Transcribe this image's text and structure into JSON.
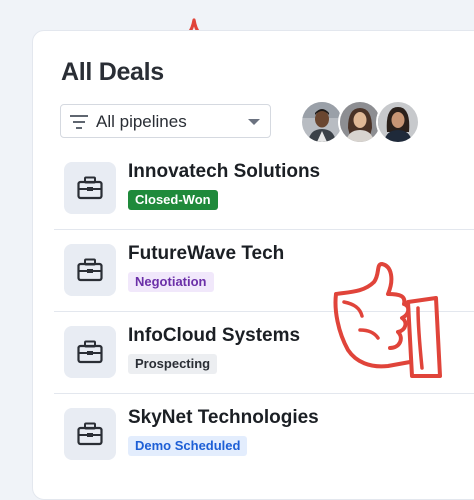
{
  "page": {
    "title": "All Deals"
  },
  "filter": {
    "selected": "All pipelines",
    "icon": "filter-icon"
  },
  "deals": [
    {
      "name": "Innovatech Solutions",
      "stage": "Closed-Won",
      "stage_color": "#ffffff",
      "stage_bg": "#1f8a3b",
      "icon": "briefcase-icon"
    },
    {
      "name": "FutureWave Tech",
      "stage": "Negotiation",
      "stage_color": "#6b2fa8",
      "stage_bg": "#f1e8fb",
      "icon": "briefcase-icon"
    },
    {
      "name": "InfoCloud Systems",
      "stage": "Prospecting",
      "stage_color": "#2a2e35",
      "stage_bg": "#eceef1",
      "icon": "briefcase-icon"
    },
    {
      "name": "SkyNet Technologies",
      "stage": "Demo Scheduled",
      "stage_color": "#1d5fd6",
      "stage_bg": "#e3edfd",
      "icon": "briefcase-icon"
    }
  ],
  "colors": {
    "accent_red": "#e0443a",
    "background": "#f0f3f8"
  }
}
